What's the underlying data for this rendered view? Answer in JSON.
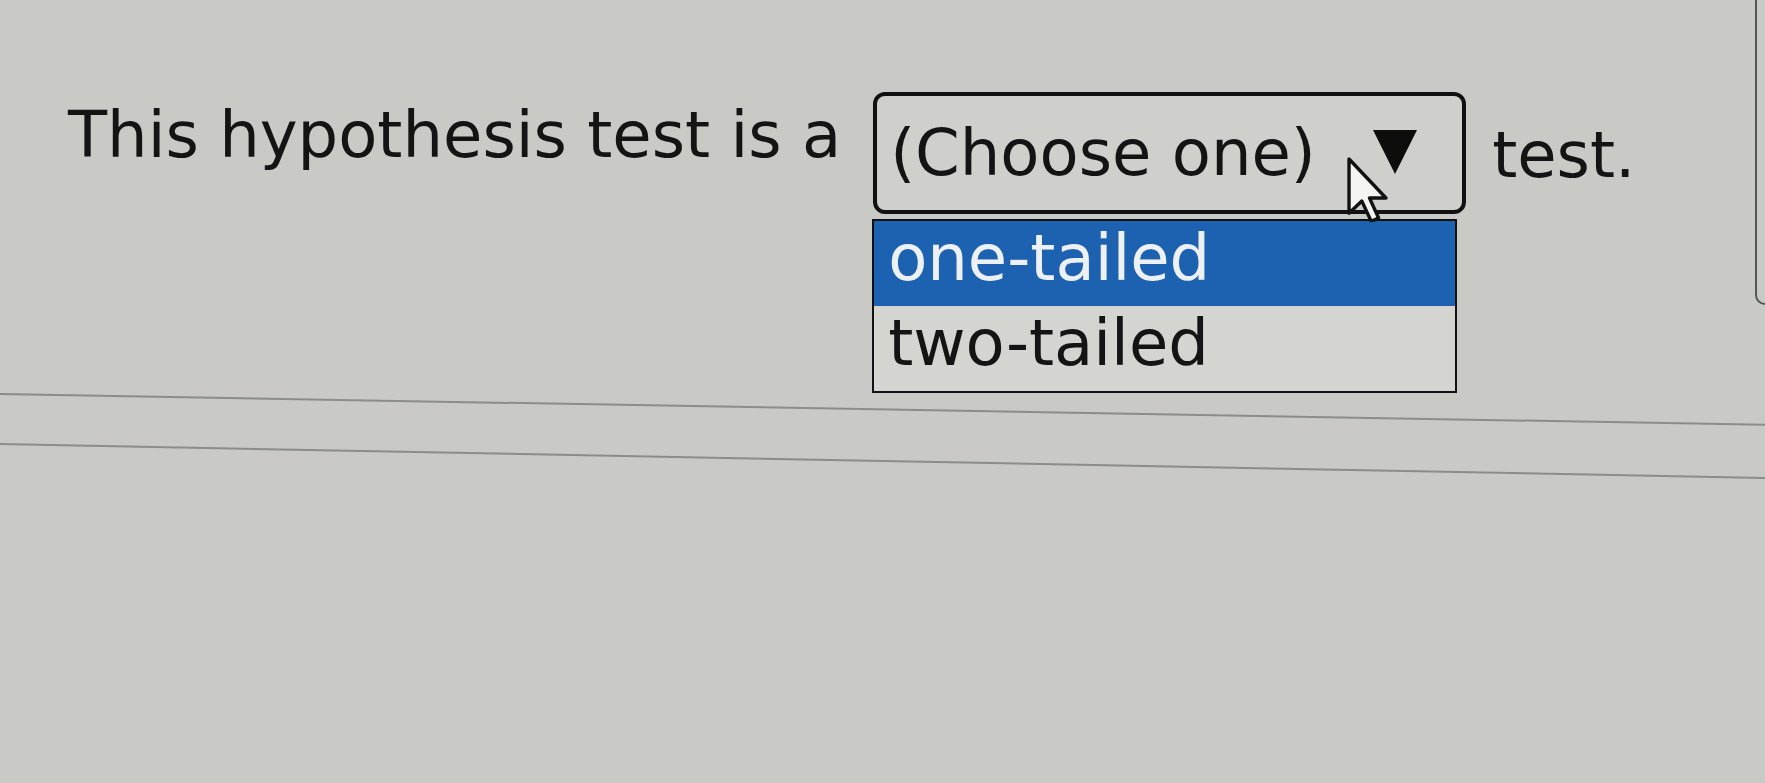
{
  "question": {
    "prefix": "This hypothesis test is a",
    "suffix": "test."
  },
  "dropdown": {
    "value": "(Choose one)",
    "expanded": true,
    "options": [
      {
        "label": "one-tailed",
        "selected": true
      },
      {
        "label": "two-tailed",
        "selected": false
      }
    ]
  }
}
